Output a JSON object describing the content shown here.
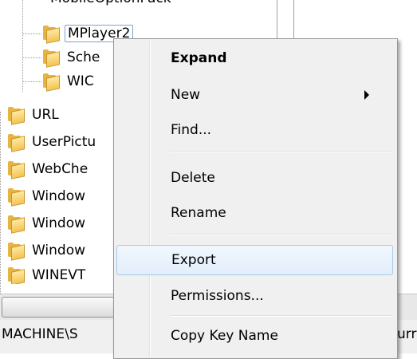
{
  "tree": {
    "top_partial_label": "MobileOptionPack",
    "items": [
      {
        "label": "MPlayer2",
        "selected": true
      },
      {
        "label": "Sche"
      },
      {
        "label": "WIC"
      },
      {
        "label": "URL"
      },
      {
        "label": "UserPictu"
      },
      {
        "label": "WebChe"
      },
      {
        "label": "Window"
      },
      {
        "label": "Window"
      },
      {
        "label": "Window"
      },
      {
        "label": "WINEVT"
      }
    ]
  },
  "status_bar": {
    "path_left": "MACHINE\\S",
    "path_right": "urr"
  },
  "context_menu": {
    "items": [
      {
        "label": "Expand",
        "bold": true
      },
      {
        "label": "New",
        "submenu": true
      },
      {
        "label": "Find..."
      },
      {
        "label": "Delete"
      },
      {
        "label": "Rename"
      },
      {
        "label": "Export",
        "hovered": true
      },
      {
        "label": "Permissions..."
      },
      {
        "label": "Copy Key Name"
      }
    ]
  },
  "colors": {
    "folder": "#e7b341",
    "menu_bg": "#f0f0f0",
    "hover_border": "#a8c8ec"
  }
}
